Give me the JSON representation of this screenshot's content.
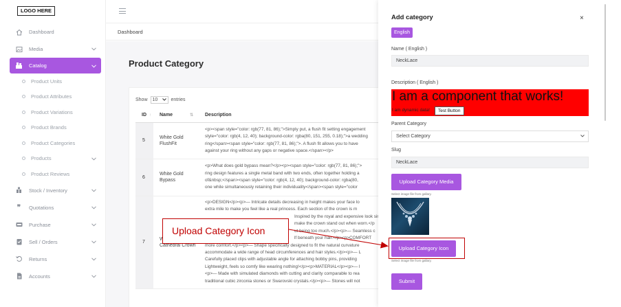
{
  "logo": "LOGO HERE",
  "sidebar": {
    "items": [
      {
        "label": "Dashboard",
        "icon": "home-icon",
        "chevron": false
      },
      {
        "label": "Media",
        "icon": "image-icon",
        "chevron": true
      },
      {
        "label": "Catalog",
        "icon": "catalog-icon",
        "chevron": true,
        "active": true
      }
    ],
    "catalog_sub": [
      {
        "label": "Product Units",
        "chevron": false
      },
      {
        "label": "Product Attributes",
        "chevron": false
      },
      {
        "label": "Product Variations",
        "chevron": false
      },
      {
        "label": "Product Brands",
        "chevron": false
      },
      {
        "label": "Product Categories",
        "chevron": false
      },
      {
        "label": "Products",
        "chevron": true
      },
      {
        "label": "Product Reviews",
        "chevron": false
      }
    ],
    "more_items": [
      {
        "label": "Stock / Inventory",
        "icon": "stock-icon"
      },
      {
        "label": "Quotations",
        "icon": "quote-icon"
      },
      {
        "label": "Purchase",
        "icon": "purchase-icon"
      },
      {
        "label": "Sell / Orders",
        "icon": "orders-icon"
      },
      {
        "label": "Returns",
        "icon": "returns-icon"
      },
      {
        "label": "Accounts",
        "icon": "accounts-icon"
      }
    ]
  },
  "breadcrumb": "Dashboard",
  "page_title": "Product Category",
  "table": {
    "show_label": "Show",
    "entries_value": "10",
    "entries_label": "entries",
    "headers": [
      "ID",
      "Name",
      "Description"
    ],
    "rows": [
      {
        "id": "5",
        "name": "White Gold FlushFit",
        "desc": [
          "<p><span style=\"color: rgb(77, 81, 86);\">Simply put, a flush fit setting engagement",
          "style=\"color: rgb(4, 12, 40); background-color: rgba(80, 151, 255, 0.18);\">a wedding",
          "ring</span><span style=\"color: rgb(77, 81, 86);\">. A flush fit allows you to have",
          "against your ring without any gaps or negative space.</span></p>"
        ]
      },
      {
        "id": "6",
        "name": "White Gold Bypass",
        "desc": [
          "<p>What does gold bypass mean?</p><p><span style=\"color: rgb(77, 81, 86);\">",
          "ring design features a single metal band with two ends, often together holding a",
          "of&nbsp;</span><span style=\"color: rgb(4, 12, 40); background-color: rgba(80,",
          "one while simultaneously retaining their individuality</span><span style=\"color"
        ]
      },
      {
        "id": "7",
        "name": "White Gold Cathedral Crown",
        "desc": [
          "<p>DESIGN</p><p>— Intricate details decreasing in height makes your face lo",
          "extra mile to make you feel like a real princess. Each section of the crown is m",
          "Inspired by the royal and expensive look similar to jewe",
          "make the crown stand out when worn.</p",
          "ut being too much.</p><p>— Seamless c",
          "lf beneath your hair.</p><p>COMFORT",
          "more comfort.</p><p>— Shape specifically designed to fit the natural curvature",
          "accommodate a wide range of head circumferences and hair styles.</p><p>— L",
          "Carefully placed clips with adjustable angle for attaching bobby pins, providing",
          "Lightweight, feels so comfy like wearing nothing!</p><p>MATERIAL</p><p>— l",
          "<p>— Made with simulated diamonds with cutting and clarity comparable to rea",
          "traditional cubic zirconia stones or Swarovski crystals.</p><p>— Stones will not"
        ]
      }
    ]
  },
  "panel": {
    "title": "Add category",
    "close": "×",
    "language_tab": "English",
    "name_label": "Name ( English )",
    "name_value": "NeckLace",
    "description_label": "Description ( English )",
    "desc_big": "I am a component that works!",
    "desc_small": "I am dynamic data!",
    "desc_button": "Test Button",
    "parent_label": "Parent Category",
    "parent_value": "Select Category",
    "slug_label": "Slug",
    "slug_value": "NeckLace",
    "upload_media_btn": "Upload Category Media",
    "hint1": "Select image file from gallary.",
    "upload_icon_btn": "Upload Category Icon",
    "hint2": "Select image file from gallary.",
    "submit_btn": "Submit"
  },
  "annotation": {
    "callout_text": "Upload Category Icon",
    "color": "#c00000"
  },
  "colors": {
    "accent": "#a857e0",
    "desc_bg": "#ff0000"
  }
}
